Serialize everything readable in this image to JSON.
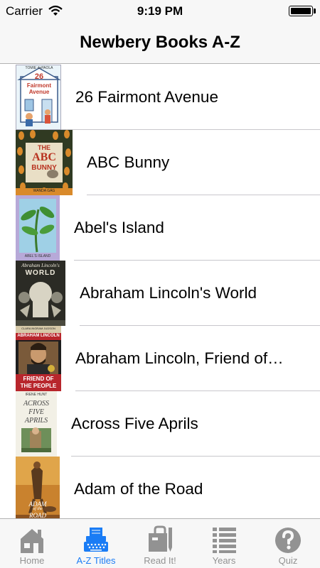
{
  "status_bar": {
    "carrier": "Carrier",
    "time": "9:19 PM"
  },
  "nav": {
    "title": "Newbery Books A-Z"
  },
  "books": [
    {
      "title": "26 Fairmont Avenue",
      "cover_text": [
        "TOMIE dePAOLA",
        "26",
        "Fairmont",
        "Avenue"
      ]
    },
    {
      "title": "ABC Bunny",
      "cover_text": [
        "THE",
        "ABC",
        "BUNNY",
        "WANDA GÁG"
      ]
    },
    {
      "title": "Abel's Island",
      "cover_text": [
        "ABEL'S ISLAND"
      ]
    },
    {
      "title": "Abraham Lincoln's World",
      "cover_text": [
        "Abraham Lincoln's",
        "WORLD"
      ]
    },
    {
      "title": "Abraham Lincoln, Friend of…",
      "cover_text": [
        "ABRAHAM LINCOLN",
        "FRIEND OF",
        "THE PEOPLE",
        "CLARA INGRAM JUDSON"
      ]
    },
    {
      "title": "Across Five Aprils",
      "cover_text": [
        "IRENE HUNT",
        "ACROSS",
        "FIVE",
        "APRILS"
      ]
    },
    {
      "title": "Adam of the Road",
      "cover_text": [
        "ADAM",
        "of the",
        "ROAD"
      ]
    }
  ],
  "tabs": [
    {
      "label": "Home",
      "icon": "house-icon",
      "active": false
    },
    {
      "label": "A-Z Titles",
      "icon": "typewriter-icon",
      "active": true
    },
    {
      "label": "Read It!",
      "icon": "book-bag-icon",
      "active": false
    },
    {
      "label": "Years",
      "icon": "list-icon",
      "active": false
    },
    {
      "label": "Quiz",
      "icon": "question-icon",
      "active": false
    }
  ],
  "colors": {
    "accent": "#1a7cf5",
    "inactive_tab": "#929292",
    "bar_background": "#f7f7f7",
    "separator": "#c8c7cc"
  }
}
